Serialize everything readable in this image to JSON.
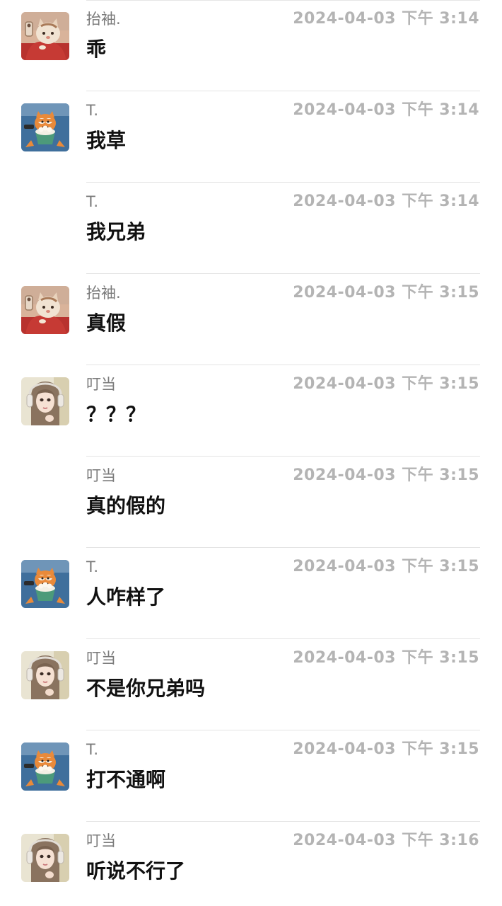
{
  "messages": [
    {
      "sender": "抬袖.",
      "avatar": "tabby-cat-avatar",
      "time": "2024-04-03 下午 3:14",
      "text": "乖"
    },
    {
      "sender": "T.",
      "avatar": "cartoon-cat-popcorn-avatar",
      "time": "2024-04-03 下午 3:14",
      "text": "我草"
    },
    {
      "sender": "T.",
      "avatar": "",
      "time": "2024-04-03 下午 3:14",
      "text": "我兄弟"
    },
    {
      "sender": "抬袖.",
      "avatar": "tabby-cat-avatar",
      "time": "2024-04-03 下午 3:15",
      "text": "真假"
    },
    {
      "sender": "叮当",
      "avatar": "girl-headphones-avatar",
      "time": "2024-04-03 下午 3:15",
      "text": "？？？"
    },
    {
      "sender": "叮当",
      "avatar": "",
      "time": "2024-04-03 下午 3:15",
      "text": "真的假的"
    },
    {
      "sender": "T.",
      "avatar": "cartoon-cat-popcorn-avatar",
      "time": "2024-04-03 下午 3:15",
      "text": "人咋样了"
    },
    {
      "sender": "叮当",
      "avatar": "girl-headphones-avatar",
      "time": "2024-04-03 下午 3:15",
      "text": "不是你兄弟吗"
    },
    {
      "sender": "T.",
      "avatar": "cartoon-cat-popcorn-avatar",
      "time": "2024-04-03 下午 3:15",
      "text": "打不通啊"
    },
    {
      "sender": "叮当",
      "avatar": "girl-headphones-avatar",
      "time": "2024-04-03 下午 3:16",
      "text": "听说不行了"
    }
  ]
}
